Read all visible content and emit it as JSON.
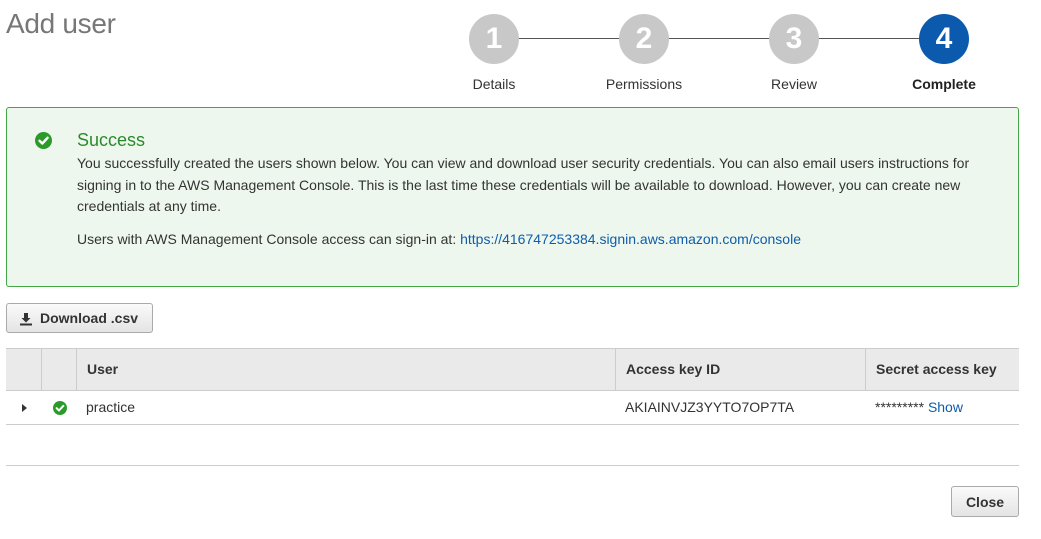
{
  "page": {
    "title": "Add user"
  },
  "stepper": {
    "steps": [
      {
        "number": "1",
        "label": "Details"
      },
      {
        "number": "2",
        "label": "Permissions"
      },
      {
        "number": "3",
        "label": "Review"
      },
      {
        "number": "4",
        "label": "Complete"
      }
    ],
    "active_step": 4
  },
  "alert": {
    "title": "Success",
    "body": "You successfully created the users shown below. You can view and download user security credentials. You can also email users instructions for signing in to the AWS Management Console. This is the last time these credentials will be available to download. However, you can create new credentials at any time.",
    "signin_prefix": "Users with AWS Management Console access can sign-in at: ",
    "signin_url": "https://416747253384.signin.aws.amazon.com/console"
  },
  "download_button": {
    "label": "Download .csv",
    "icon": "download-icon"
  },
  "table": {
    "columns": [
      "User",
      "Access key ID",
      "Secret access key"
    ],
    "rows": [
      {
        "user": "practice",
        "access_key_id": "AKIAINVJZ3YYTO7OP7TA",
        "secret_masked": "*********",
        "secret_show": "Show"
      }
    ]
  },
  "close_button": {
    "label": "Close"
  },
  "colors": {
    "accent": "#0c5aad",
    "success": "#2b9a2b",
    "link": "#0e5daa",
    "inactive_step": "#c8c8c8"
  }
}
